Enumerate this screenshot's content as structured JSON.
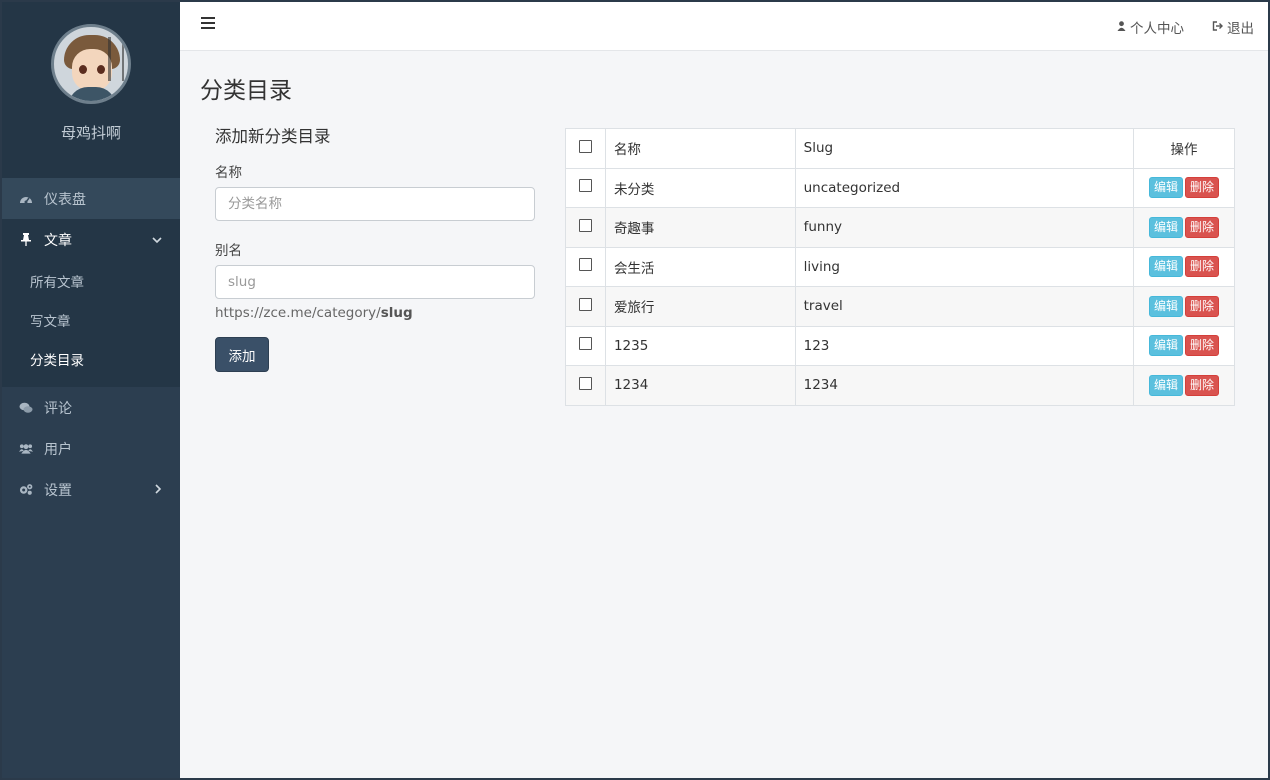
{
  "sidebar": {
    "username": "母鸡抖啊",
    "items": [
      {
        "label": "仪表盘",
        "icon": "dashboard-icon"
      },
      {
        "label": "文章",
        "icon": "pin-icon"
      },
      {
        "label": "评论",
        "icon": "comments-icon"
      },
      {
        "label": "用户",
        "icon": "users-icon"
      },
      {
        "label": "设置",
        "icon": "gears-icon"
      }
    ],
    "sub_items": [
      {
        "label": "所有文章"
      },
      {
        "label": "写文章"
      },
      {
        "label": "分类目录"
      }
    ]
  },
  "header": {
    "profile_label": "个人中心",
    "logout_label": "退出"
  },
  "page": {
    "title": "分类目录"
  },
  "form": {
    "title": "添加新分类目录",
    "name_label": "名称",
    "name_placeholder": "分类名称",
    "slug_label": "别名",
    "slug_placeholder": "slug",
    "url_prefix": "https://zce.me/category/",
    "url_slug": "slug",
    "submit_label": "添加"
  },
  "table": {
    "headers": {
      "name": "名称",
      "slug": "Slug",
      "actions": "操作"
    },
    "edit_label": "编辑",
    "delete_label": "删除",
    "rows": [
      {
        "name": "未分类",
        "slug": "uncategorized"
      },
      {
        "name": "奇趣事",
        "slug": "funny"
      },
      {
        "name": "会生活",
        "slug": "living"
      },
      {
        "name": "爱旅行",
        "slug": "travel"
      },
      {
        "name": "1235",
        "slug": "123"
      },
      {
        "name": "1234",
        "slug": "1234"
      }
    ]
  },
  "colors": {
    "sidebar_bg": "#2c3e50",
    "primary_button": "#3a5068",
    "edit_button": "#5bc0de",
    "delete_button": "#d9534f"
  }
}
